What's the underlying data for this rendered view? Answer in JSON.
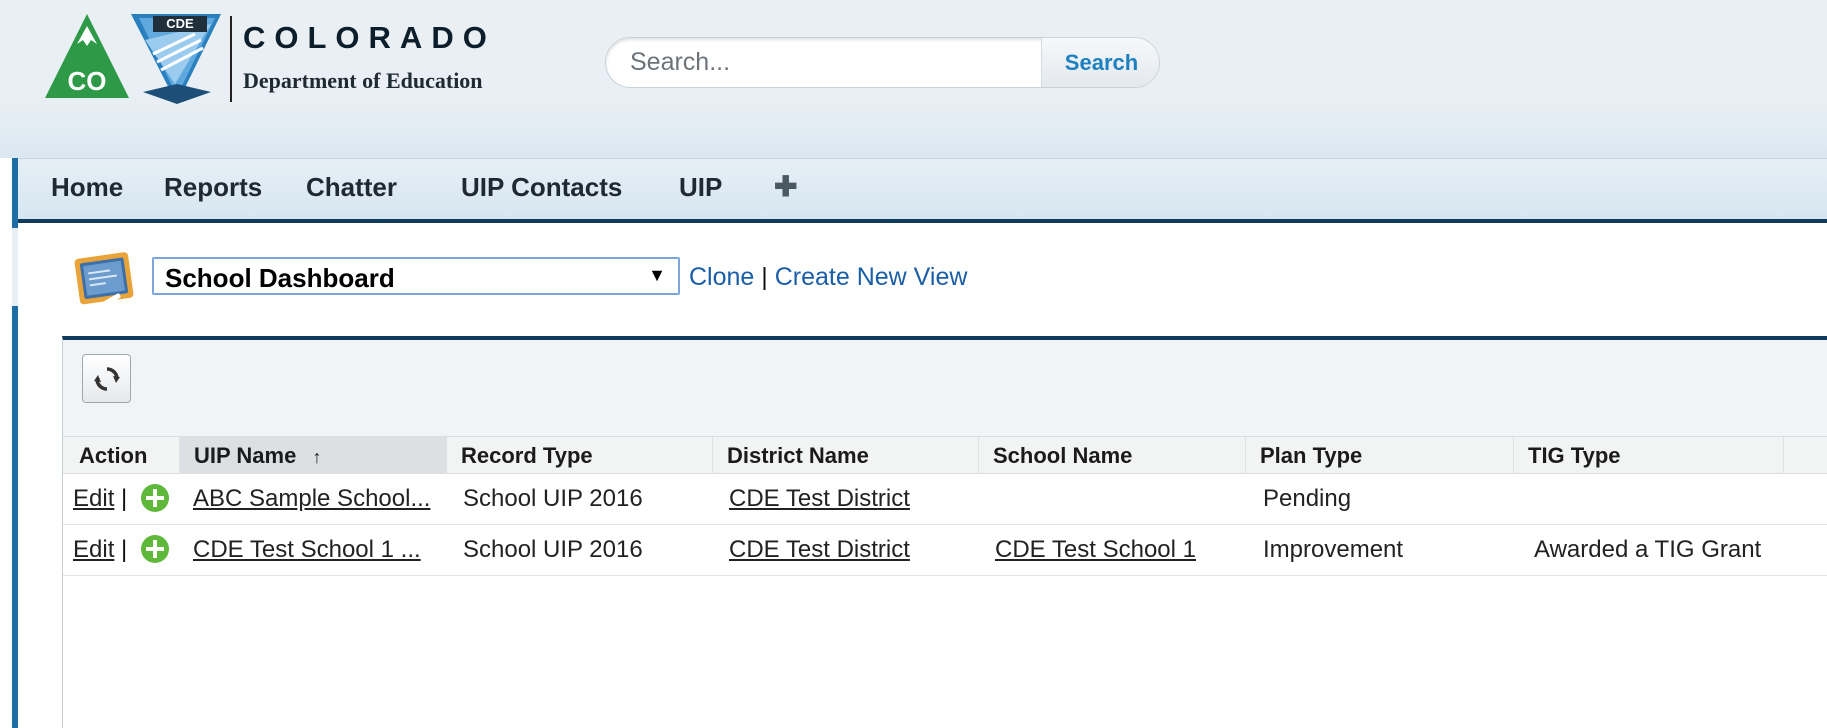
{
  "header": {
    "logo": {
      "badge_text": "CDE",
      "mark_text": "CO",
      "title": "COLORADO",
      "subtitle": "Department of Education"
    },
    "search": {
      "placeholder": "Search...",
      "button_label": "Search"
    }
  },
  "tabs": [
    {
      "label": "Home"
    },
    {
      "label": "Reports"
    },
    {
      "label": "Chatter"
    },
    {
      "label": "UIP Contacts"
    },
    {
      "label": "UIP"
    },
    {
      "label": "✚"
    }
  ],
  "view": {
    "selected": "School Dashboard",
    "arrow": "▼",
    "clone_label": "Clone",
    "separator": "|",
    "create_label": "Create New View"
  },
  "table": {
    "columns": [
      {
        "label": "Action"
      },
      {
        "label": "UIP Name",
        "sort_indicator": "↑"
      },
      {
        "label": "Record Type"
      },
      {
        "label": "District Name"
      },
      {
        "label": "School Name"
      },
      {
        "label": "Plan Type"
      },
      {
        "label": "TIG Type"
      }
    ],
    "rows": [
      {
        "edit": "Edit",
        "sep": "|",
        "uip_name": "ABC Sample School...",
        "record_type": "School UIP 2016",
        "district_name": "CDE Test District",
        "school_name": "",
        "plan_type": "Pending",
        "tig_type": ""
      },
      {
        "edit": "Edit",
        "sep": "|",
        "uip_name": "CDE Test School 1 ...",
        "record_type": "School UIP 2016",
        "district_name": "CDE Test District",
        "school_name": "CDE Test School 1",
        "plan_type": "Improvement",
        "tig_type": "Awarded a TIG Grant"
      }
    ]
  },
  "colors": {
    "nav_dark": "#0f3a5c",
    "link_blue": "#1b5ea7",
    "logo_green": "#2e9a47",
    "logo_blue": "#3b8fd0",
    "add_green": "#5fb83a"
  }
}
